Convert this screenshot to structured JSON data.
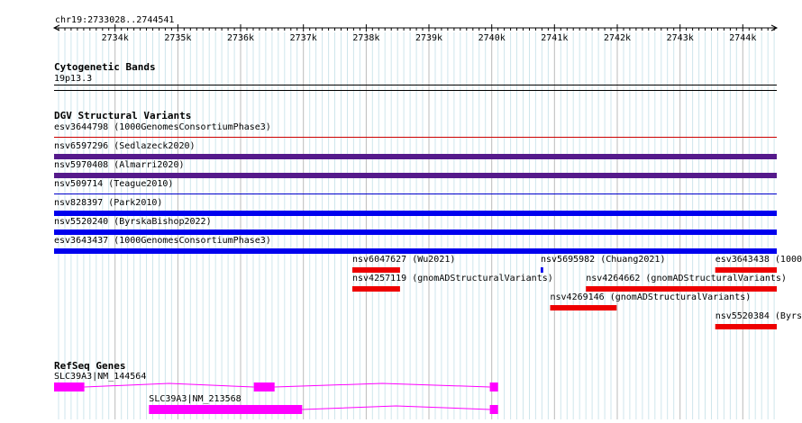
{
  "ruler": {
    "region": "chr19:2733028..2744541",
    "start": 2733028,
    "end": 2744541,
    "ticks": [
      {
        "pos": 2734000,
        "label": "2734k"
      },
      {
        "pos": 2735000,
        "label": "2735k"
      },
      {
        "pos": 2736000,
        "label": "2736k"
      },
      {
        "pos": 2737000,
        "label": "2737k"
      },
      {
        "pos": 2738000,
        "label": "2738k"
      },
      {
        "pos": 2739000,
        "label": "2739k"
      },
      {
        "pos": 2740000,
        "label": "2740k"
      },
      {
        "pos": 2741000,
        "label": "2741k"
      },
      {
        "pos": 2742000,
        "label": "2742k"
      },
      {
        "pos": 2743000,
        "label": "2743k"
      },
      {
        "pos": 2744000,
        "label": "2744k"
      }
    ],
    "minor_step": 100
  },
  "tracks": {
    "cytoband": {
      "title": "Cytogenetic Bands",
      "band_label": "19p13.3",
      "color": "#000000"
    },
    "dgv": {
      "title": "DGV Structural Variants",
      "features": [
        {
          "label": "esv3644798 (1000GenomesConsortiumPhase3)",
          "start": 2733028,
          "end": 2744541,
          "color": "#cc0000",
          "thick": false
        },
        {
          "label": "nsv6597296 (Sedlazeck2020)",
          "start": 2733028,
          "end": 2744541,
          "color": "#551a8b",
          "thick": true
        },
        {
          "label": "nsv5970408 (Almarri2020)",
          "start": 2733028,
          "end": 2744541,
          "color": "#551a8b",
          "thick": true
        },
        {
          "label": "nsv509714 (Teague2010)",
          "start": 2733028,
          "end": 2744541,
          "color": "#0000cc",
          "thick": false
        },
        {
          "label": "nsv828397 (Park2010)",
          "start": 2733028,
          "end": 2744541,
          "color": "#0000ee",
          "thick": true
        },
        {
          "label": "nsv5520240 (ByrskaBishop2022)",
          "start": 2733028,
          "end": 2744541,
          "color": "#0000ee",
          "thick": true
        },
        {
          "label": "esv3643437 (1000GenomesConsortiumPhase3)",
          "start": 2733028,
          "end": 2744541,
          "color": "#0000ee",
          "thick": true
        },
        {
          "label": "nsv6047627 (Wu2021)",
          "start": 2737780,
          "end": 2738540,
          "color": "#ee0000",
          "thick": true
        },
        {
          "label": "nsv5695982 (Chuang2021)",
          "start": 2740780,
          "end": 2740820,
          "color": "#0000ee",
          "thick": true
        },
        {
          "label": "esv3643438 (1000",
          "start": 2743560,
          "end": 2744541,
          "color": "#ee0000",
          "thick": true
        },
        {
          "label": "nsv4257119 (gnomADStructuralVariants)",
          "start": 2737780,
          "end": 2738540,
          "color": "#ee0000",
          "thick": true
        },
        {
          "label": "nsv4264662 (gnomADStructuralVariants)",
          "start": 2741500,
          "end": 2744541,
          "color": "#ee0000",
          "thick": true
        },
        {
          "label": "nsv4269146 (gnomADStructuralVariants)",
          "start": 2740930,
          "end": 2741990,
          "color": "#ee0000",
          "thick": true
        },
        {
          "label": "nsv5520384 (Byrs",
          "start": 2743560,
          "end": 2744541,
          "color": "#ee0000",
          "thick": true
        }
      ]
    },
    "refseq": {
      "title": "RefSeq Genes",
      "color": "#ff00ff",
      "genes": [
        {
          "label": "SLC39A3|NM_144564",
          "start": 2733028,
          "end": 2740100,
          "exons": [
            [
              2733028,
              2733510
            ],
            [
              2736210,
              2736540
            ],
            [
              2739970,
              2740100
            ]
          ]
        },
        {
          "label": "SLC39A3|NM_213568",
          "start": 2734540,
          "end": 2740100,
          "exons": [
            [
              2734540,
              2736980
            ],
            [
              2739970,
              2740100
            ]
          ]
        }
      ]
    }
  }
}
